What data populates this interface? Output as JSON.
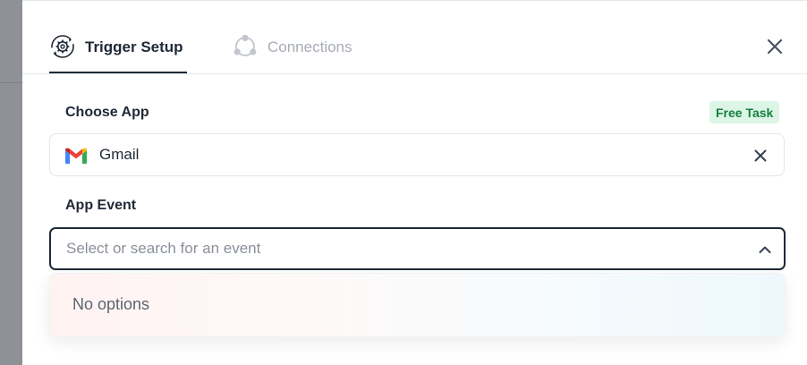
{
  "tabs": {
    "trigger_setup": {
      "label": "Trigger Setup",
      "icon": "gear-sync-icon"
    },
    "connections": {
      "label": "Connections",
      "icon": "connections-icon"
    }
  },
  "choose_app": {
    "label": "Choose App",
    "badge": "Free Task",
    "selected_app": "Gmail",
    "app_icon": "gmail-icon"
  },
  "app_event": {
    "label": "App Event",
    "placeholder": "Select or search for an event",
    "dropdown_message": "No options"
  },
  "colors": {
    "text_primary": "#1f2937",
    "muted": "#a7adb5",
    "badge_bg": "#dcf5e6",
    "badge_text": "#15803d",
    "backdrop": "#8e9297"
  }
}
